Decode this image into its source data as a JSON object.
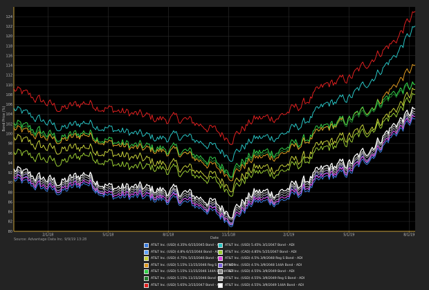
{
  "chart_data": {
    "type": "line",
    "xlabel": "Date",
    "ylabel": "Bond Price (%)",
    "ylim": [
      80,
      126
    ],
    "y_ticks": [
      80,
      82,
      84,
      86,
      88,
      90,
      92,
      94,
      96,
      98,
      100,
      102,
      104,
      106,
      108,
      110,
      112,
      114,
      116,
      118,
      120,
      122,
      124
    ],
    "x_ticks": [
      {
        "pos": 0.085,
        "label": "2/1/18"
      },
      {
        "pos": 0.235,
        "label": "5/1/18"
      },
      {
        "pos": 0.385,
        "label": "8/1/18"
      },
      {
        "pos": 0.535,
        "label": "11/1/18"
      },
      {
        "pos": 0.685,
        "label": "2/1/19"
      },
      {
        "pos": 0.835,
        "label": "5/1/19"
      },
      {
        "pos": 0.985,
        "label": "8/1/19"
      }
    ],
    "grid": true,
    "legend_position": "bottom",
    "x_range": [
      0,
      1
    ],
    "anchor_x": [
      0,
      0.06,
      0.12,
      0.18,
      0.24,
      0.3,
      0.36,
      0.42,
      0.48,
      0.54,
      0.6,
      0.66,
      0.72,
      0.78,
      0.84,
      0.9,
      0.95,
      1
    ],
    "series": [
      {
        "name": "AT&T Inc. (USD) 4.35% 6/15/2045 Bond - ADI",
        "color": "#3a7de0",
        "values": [
          90.5,
          89,
          88,
          90,
          87,
          87,
          86.5,
          86,
          84.5,
          82,
          86,
          86,
          88,
          91,
          92,
          96,
          100,
          103
        ]
      },
      {
        "name": "AT&T Inc. (USD) 5.45% 3/1/2047 Bond - ADI",
        "color": "#27c4c4",
        "values": [
          105,
          103,
          101,
          102.5,
          101,
          100,
          99,
          99.5,
          98,
          95.5,
          99,
          99.5,
          102,
          106,
          107.5,
          112,
          116,
          122
        ]
      },
      {
        "name": "AT&T Inc. (USD) 4.8% 6/15/2044 Bond - ADI",
        "color": "#5fa3ff",
        "values": [
          91,
          89.5,
          88.5,
          90.5,
          87.5,
          87.5,
          87,
          86.5,
          85,
          82.5,
          86.5,
          86.5,
          88.5,
          91.5,
          92.5,
          96.5,
          100.5,
          103.5
        ]
      },
      {
        "name": "AT&T Inc. (CAD) 4.85% 5/25/2047 Bond - ADI",
        "color": "#9acd32",
        "values": [
          96,
          95,
          94,
          96,
          94,
          93,
          93,
          92,
          91,
          88.5,
          92,
          92,
          94,
          97,
          98.5,
          101.5,
          104,
          108
        ]
      },
      {
        "name": "AT&T Inc. (USD) 4.75% 5/15/2046 Bond - ADI",
        "color": "#c8d23a",
        "values": [
          99,
          97.5,
          96.5,
          97.5,
          96,
          95,
          94,
          93,
          92,
          89.5,
          93,
          93,
          95,
          98,
          99.5,
          102,
          105,
          109
        ]
      },
      {
        "name": "AT&T Inc. (USD) 4.5% 3/9/2048 Reg S Bond - ADI",
        "color": "#e040e0",
        "values": [
          91,
          89.5,
          88.5,
          90.5,
          87.5,
          87.5,
          87,
          86.5,
          85,
          82.5,
          86.5,
          86.5,
          88.5,
          91.5,
          92.5,
          96.5,
          100.5,
          103.5
        ]
      },
      {
        "name": "AT&T Inc. (USD) 5.15% 11/15/2046 Reg S Bond - ADI",
        "color": "#e09a20",
        "values": [
          101,
          99.5,
          98.5,
          100,
          98,
          97,
          96.5,
          96,
          94,
          91.5,
          95,
          95.5,
          98,
          101,
          103,
          106,
          110,
          114
        ]
      },
      {
        "name": "AT&T Inc. (USD) 4.5% 3/9/2048 144A Bond - ADI",
        "color": "#7a5fe0",
        "values": [
          91.5,
          90,
          89,
          91,
          88,
          88,
          87.5,
          87,
          85.5,
          83,
          87,
          87,
          89,
          92,
          93,
          97,
          101,
          104
        ]
      },
      {
        "name": "AT&T Inc. (USD) 5.15% 11/15/2046 144A Bond - ADI",
        "color": "#33d04a",
        "values": [
          102,
          100.5,
          99,
          100.5,
          98.5,
          97.5,
          97,
          96.5,
          95,
          92.5,
          96,
          96.5,
          98.5,
          101.5,
          103,
          106,
          108.5,
          110
        ]
      },
      {
        "name": "AT&T Inc. (USD) 4.55% 3/9/2049 Bond - ADI",
        "color": "#8a8a8a",
        "values": [
          91.5,
          90,
          89,
          91,
          88,
          88,
          87.5,
          87,
          85.5,
          83,
          87,
          87,
          89,
          92,
          93,
          97,
          101,
          104
        ]
      },
      {
        "name": "AT&T Inc. (USD) 5.15% 11/15/2046 Bond - ADI",
        "color": "#1e7a2a",
        "values": [
          101.5,
          100,
          98.5,
          100,
          98,
          97,
          96.5,
          96,
          94.5,
          92,
          95.5,
          96,
          98,
          101,
          102.5,
          105.5,
          108,
          110
        ]
      },
      {
        "name": "AT&T Inc. (USD) 4.55% 3/9/2049 Reg S Bond - ADI",
        "color": "#b0b0b0",
        "values": [
          92,
          90.5,
          89.5,
          91.5,
          88.5,
          88.5,
          88,
          87.5,
          86,
          83.5,
          87.5,
          87.5,
          89.5,
          92.5,
          93.5,
          97.5,
          101.5,
          104.5
        ]
      },
      {
        "name": "AT&T Inc. (USD) 5.65% 2/15/2047 Bond - ADI",
        "color": "#e02020",
        "values": [
          109,
          107,
          105,
          106.5,
          105,
          104,
          103,
          103,
          101.5,
          99,
          103,
          103.5,
          106,
          110,
          111.5,
          116,
          119,
          125
        ]
      },
      {
        "name": "AT&T Inc. (USD) 4.55% 3/9/2049 144A Bond - ADI",
        "color": "#ffffff",
        "values": [
          92.5,
          91,
          90,
          92,
          89,
          89,
          88.5,
          88,
          86.5,
          84,
          88,
          88,
          90,
          93,
          94,
          98,
          102,
          105
        ]
      }
    ]
  },
  "source_text": "Source: Advantage Data Inc. 9/9/19 13:28",
  "legend": [
    {
      "label": "AT&T Inc. (USD) 4.35% 6/15/2045 Bond - ADI",
      "color": "#3a7de0"
    },
    {
      "label": "AT&T Inc. (USD) 5.45% 3/1/2047 Bond - ADI",
      "color": "#27c4c4"
    },
    {
      "label": "AT&T Inc. (USD) 4.8% 6/15/2044 Bond - ADI",
      "color": "#5fa3ff"
    },
    {
      "label": "AT&T Inc. (CAD) 4.85% 5/25/2047 Bond - ADI",
      "color": "#9acd32"
    },
    {
      "label": "AT&T Inc. (USD) 4.75% 5/15/2046 Bond - ADI",
      "color": "#c8d23a"
    },
    {
      "label": "AT&T Inc. (USD) 4.5% 3/9/2048 Reg S Bond - ADI",
      "color": "#e040e0"
    },
    {
      "label": "AT&T Inc. (USD) 5.15% 11/15/2046 Reg S Bond - ADI",
      "color": "#e09a20"
    },
    {
      "label": "AT&T Inc. (USD) 4.5% 3/9/2048 144A Bond - ADI",
      "color": "#7a5fe0"
    },
    {
      "label": "AT&T Inc. (USD) 5.15% 11/15/2046 144A Bond - ADI",
      "color": "#33d04a"
    },
    {
      "label": "AT&T Inc. (USD) 4.55% 3/9/2049 Bond - ADI",
      "color": "#8a8a8a"
    },
    {
      "label": "AT&T Inc. (USD) 5.15% 11/15/2046 Bond - ADI",
      "color": "#1e7a2a"
    },
    {
      "label": "AT&T Inc. (USD) 4.55% 3/9/2049 Reg S Bond - ADI",
      "color": "#b0b0b0"
    },
    {
      "label": "AT&T Inc. (USD) 5.65% 2/15/2047 Bond - ADI",
      "color": "#e02020"
    },
    {
      "label": "AT&T Inc. (USD) 4.55% 3/9/2049 144A Bond - ADI",
      "color": "#ffffff"
    }
  ]
}
